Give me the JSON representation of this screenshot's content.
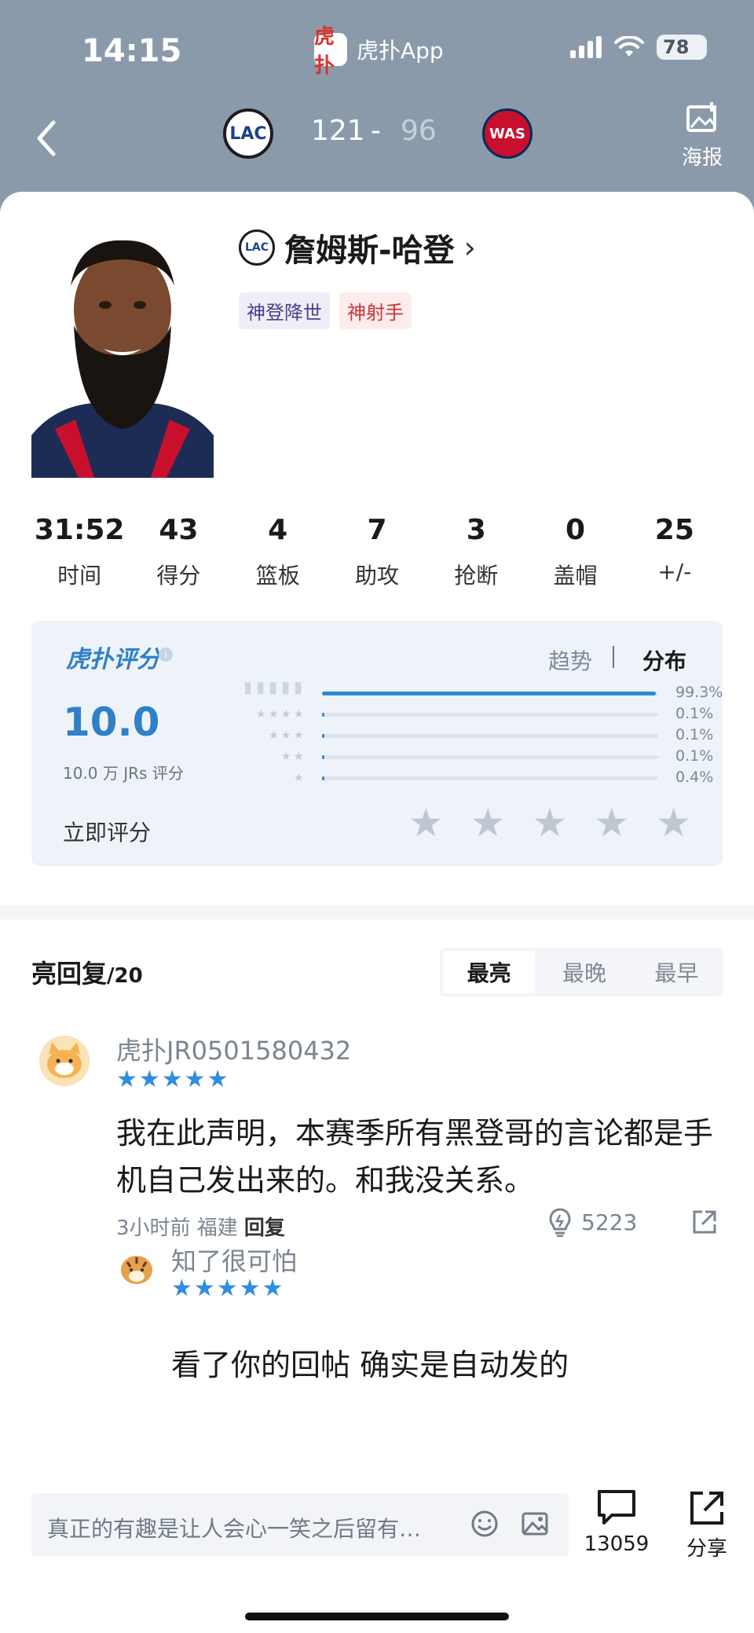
{
  "status_bar": {
    "time": "14:15",
    "app_name": "虎扑App",
    "app_logo_text": "虎扑",
    "battery": "78"
  },
  "game": {
    "home_team_abbr": "LAC",
    "away_team_abbr": "WAS",
    "home_score": "121",
    "separator": "-",
    "away_score": "96",
    "poster_label": "海报"
  },
  "player": {
    "team_abbr": "LAC",
    "name": "詹姆斯-哈登",
    "chevron": "›",
    "tags": [
      "神登降世",
      "神射手"
    ]
  },
  "stats": [
    {
      "value": "31:52",
      "label": "时间"
    },
    {
      "value": "43",
      "label": "得分"
    },
    {
      "value": "4",
      "label": "篮板"
    },
    {
      "value": "7",
      "label": "助攻"
    },
    {
      "value": "3",
      "label": "抢断"
    },
    {
      "value": "0",
      "label": "盖帽"
    },
    {
      "value": "25",
      "label": "+/-"
    }
  ],
  "rating": {
    "brand": "虎扑评分",
    "brand_reg": "®",
    "info_icon": "i",
    "trend_tab": "趋势",
    "dist_tab": "分布",
    "score": "10.0",
    "count_text": "10.0 万 JRs 评分",
    "distribution": [
      {
        "stars": 5,
        "percent": 99.3,
        "label": "99.3%"
      },
      {
        "stars": 4,
        "percent": 0.1,
        "label": "0.1%"
      },
      {
        "stars": 3,
        "percent": 0.1,
        "label": "0.1%"
      },
      {
        "stars": 2,
        "percent": 0.1,
        "label": "0.1%"
      },
      {
        "stars": 1,
        "percent": 0.4,
        "label": "0.4%"
      }
    ],
    "rate_now": "立即评分",
    "accent_color": "#2f80c7"
  },
  "replies": {
    "title": "亮回复",
    "count": "/20",
    "sort_options": [
      "最亮",
      "最晚",
      "最早"
    ],
    "active_sort": "最亮"
  },
  "comment": {
    "username": "虎扑JR0501580432",
    "stars": "★★★★★",
    "text": "我在此声明，本赛季所有黑登哥的言论都是手机自己发出来的。和我没关系。",
    "meta": "3小时前 福建",
    "reply_label": "回复",
    "likes": "5223"
  },
  "subreply": {
    "username": "知了很可怕",
    "stars": "★★★★★",
    "text": "看了你的回帖 确实是自动发的"
  },
  "bottom_bar": {
    "input_placeholder": "真正的有趣是让人会心一笑之后留有…",
    "comment_count": "13059",
    "share_label": "分享"
  }
}
